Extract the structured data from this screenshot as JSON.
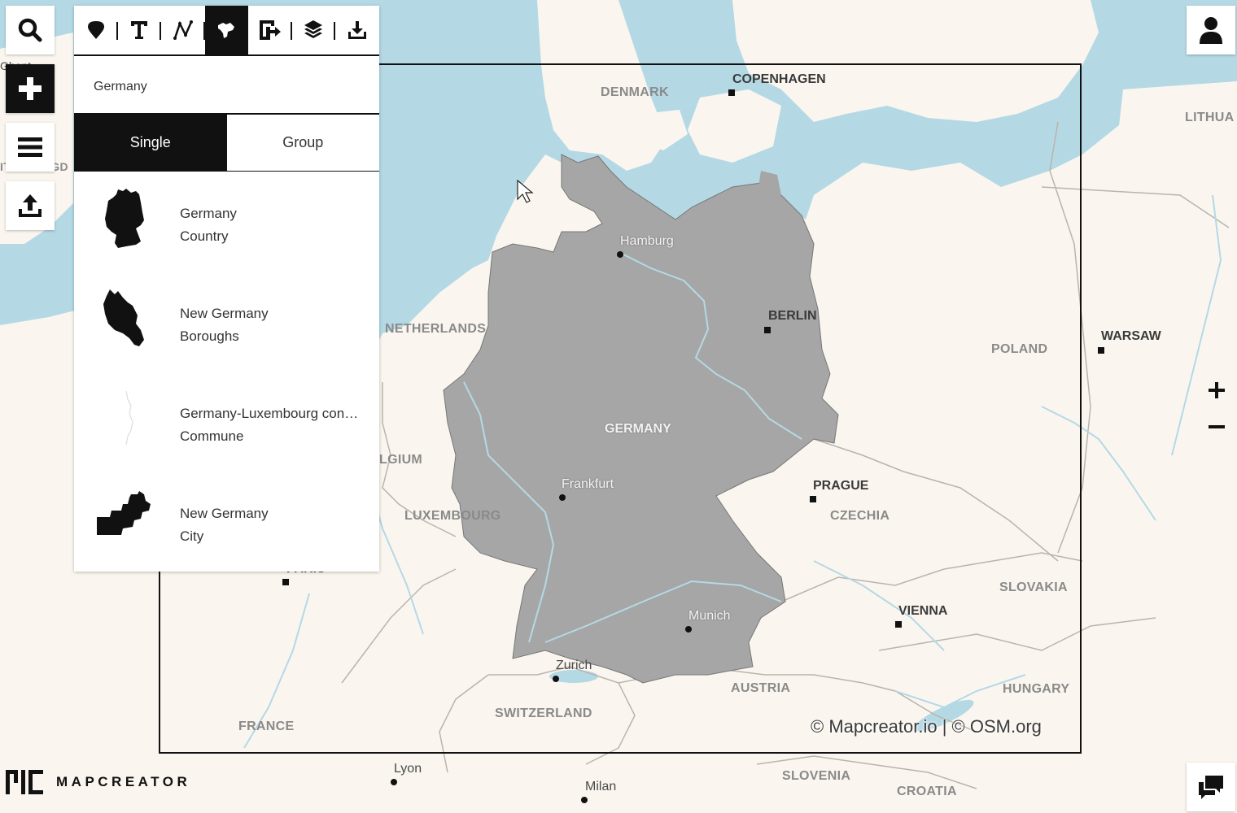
{
  "app": {
    "logo_text": "MAPCREATOR"
  },
  "toolbar": {
    "tools": [
      {
        "icon": "marker-icon"
      },
      {
        "icon": "text-icon"
      },
      {
        "icon": "polyline-icon"
      },
      {
        "icon": "area-icon",
        "active": true
      },
      {
        "icon": "import-shape-icon"
      },
      {
        "icon": "layers-icon"
      },
      {
        "icon": "download-icon"
      }
    ]
  },
  "search": {
    "value": "Germany",
    "placeholder": ""
  },
  "mode": {
    "single": "Single",
    "group": "Group",
    "selected": "Single"
  },
  "results": [
    {
      "title": "Germany",
      "subtitle": "Country"
    },
    {
      "title": "New Germany",
      "subtitle": "Boroughs"
    },
    {
      "title": "Germany-Luxembourg condominium",
      "subtitle": "Commune"
    },
    {
      "title": "New Germany",
      "subtitle": "City"
    }
  ],
  "map": {
    "attribution": "© Mapcreator.io | © OSM.org",
    "labels": {
      "denmark": "DENMARK",
      "copenhagen": "COPENHAGEN",
      "lithuania": "LITHUA",
      "hamburg": "Hamburg",
      "berlin": "BERLIN",
      "netherlands": "NETHERLANDS",
      "poland": "POLAND",
      "warsaw": "WARSAW",
      "germany": "GERMANY",
      "belgium": "LGIUM",
      "frankfurt": "Frankfurt",
      "prague": "PRAGUE",
      "czechia": "CZECHIA",
      "luxembourg": "LUXEMBOURG",
      "paris": "PARIS",
      "slovakia": "SLOVAKIA",
      "vienna": "VIENNA",
      "munich": "Munich",
      "zurich": "Zurich",
      "austria": "AUSTRIA",
      "hungary": "HUNGARY",
      "switzerland": "SWITZERLAND",
      "france": "FRANCE",
      "lyon": "Lyon",
      "milan": "Milan",
      "slovenia": "SLOVENIA",
      "croatia": "CROATIA",
      "ghent": "Ghent",
      "united_kingdom": "ITED KINGD"
    }
  },
  "colors": {
    "land": "#faf6ef",
    "water": "#b4d9e5",
    "highlight": "#a6a6a6",
    "accent": "#111111"
  }
}
